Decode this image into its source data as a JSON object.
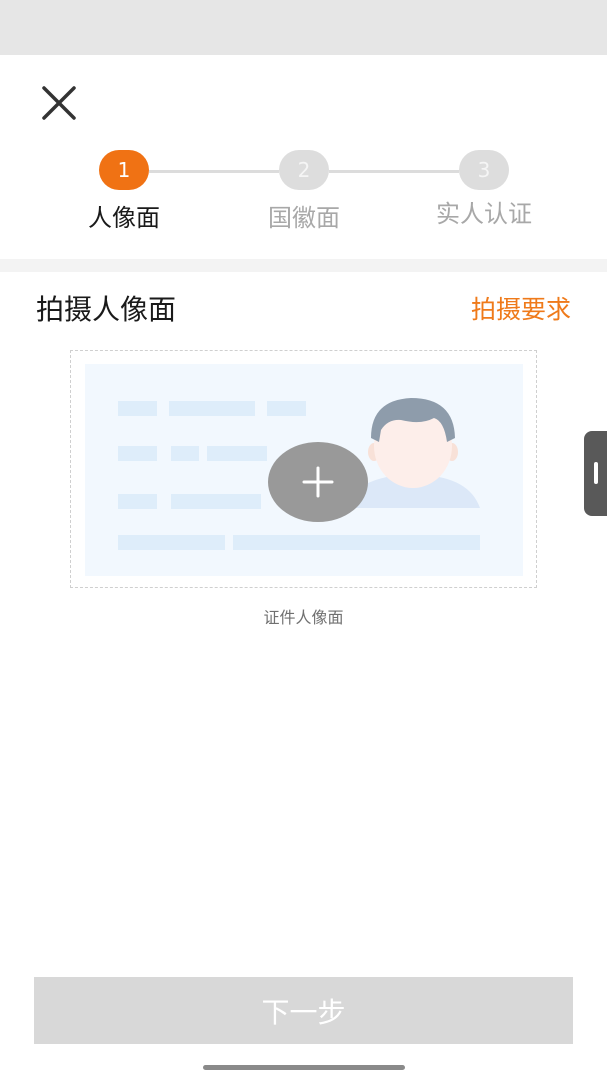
{
  "header": {
    "close_icon": "close-icon"
  },
  "steps": [
    {
      "number": "1",
      "label": "人像面",
      "state": "active"
    },
    {
      "number": "2",
      "label": "国徽面",
      "state": "inactive"
    },
    {
      "number": "3",
      "label": "实人认证",
      "state": "inactive"
    }
  ],
  "section": {
    "title": "拍摄人像面",
    "requirements_link": "拍摄要求"
  },
  "upload": {
    "caption": "证件人像面",
    "add_icon": "plus-icon",
    "illustration": "id-card-portrait-illustration"
  },
  "footer": {
    "next_label": "下一步"
  },
  "colors": {
    "accent": "#f07214",
    "link": "#ef7a1a",
    "inactive_step": "#dddddd",
    "disabled_button": "#d8d8d8",
    "card_background": "#f2f8fe",
    "card_lines": "#deedfa"
  }
}
